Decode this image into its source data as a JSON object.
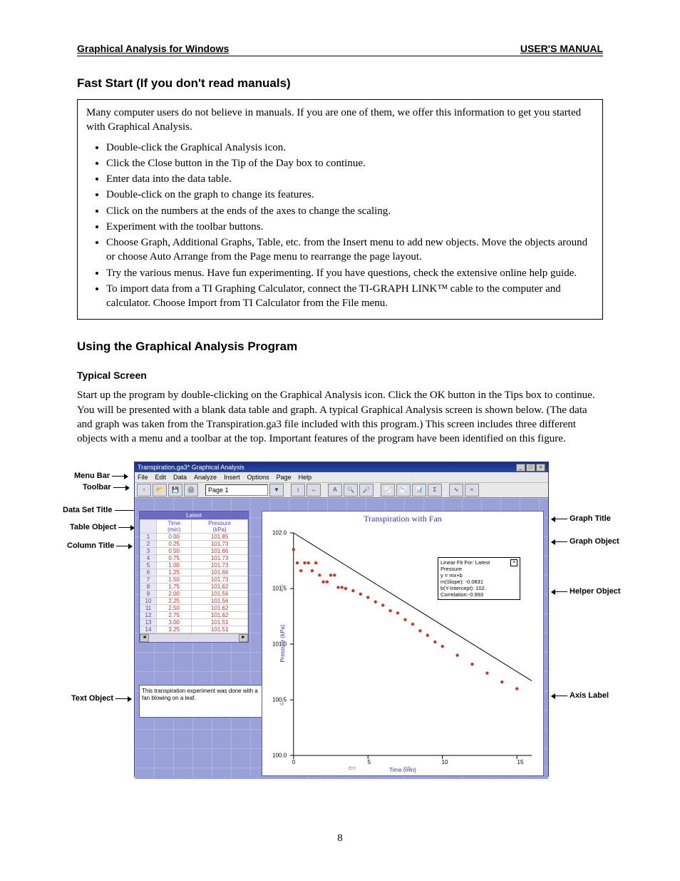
{
  "header": {
    "left": "Graphical Analysis for Windows",
    "right": "USER'S MANUAL"
  },
  "section1": {
    "title": "Fast Start (If you don't read manuals)",
    "intro": "Many computer users do not believe in manuals. If you are one of them, we offer this information to get you started with Graphical Analysis.",
    "bullets": [
      "Double-click the Graphical Analysis icon.",
      "Click the Close button in the Tip of the Day box to continue.",
      "Enter data into the data table.",
      "Double-click on the graph to change its features.",
      "Click on the numbers at the ends of the axes to change the scaling.",
      "Experiment with the toolbar buttons.",
      "Choose Graph, Additional Graphs, Table, etc. from the Insert menu to add new objects. Move the objects around or choose Auto Arrange from the Page menu to rearrange the page layout.",
      "Try the various menus. Have fun experimenting. If you have questions, check the extensive online help guide.",
      "To import data from a TI Graphing Calculator, connect the TI-GRAPH LINK™ cable to the computer and calculator. Choose Import from TI Calculator from the File menu."
    ]
  },
  "section2": {
    "title": "Using the Graphical Analysis Program",
    "sub": "Typical Screen",
    "body": "Start up the program by double-clicking on the Graphical Analysis icon. Click the OK button in the Tips box to continue. You will be presented with a blank data table and graph. A typical Graphical Analysis screen is shown below. (The data and graph was taken from the Transpiration.ga3 file included with this program.) This screen includes three different objects with a menu and a toolbar at the top. Important features of the program have been identified on this figure."
  },
  "figure": {
    "labels_left": {
      "menu_bar": "Menu Bar",
      "toolbar": "Toolbar",
      "data_set_title": "Data Set Title",
      "table_object": "Table Object",
      "column_title": "Column Title",
      "text_object": "Text Object"
    },
    "labels_right": {
      "graph_title": "Graph Title",
      "graph_object": "Graph Object",
      "helper_object": "Helper Object",
      "axis_label": "Axis Label"
    },
    "window_title": "Transpiration.ga3* Graphical Analysis",
    "menus": [
      "File",
      "Edit",
      "Data",
      "Analyze",
      "Insert",
      "Options",
      "Page",
      "Help"
    ],
    "page_selector": "Page 1",
    "dataset_title": "Latest",
    "table": {
      "col1": "Time",
      "col1_unit": "(min)",
      "col2": "Pressure",
      "col2_unit": "(kPa)",
      "rows": [
        [
          "1",
          "0.00",
          "101.85"
        ],
        [
          "2",
          "0.25",
          "101.73"
        ],
        [
          "3",
          "0.50",
          "101.66"
        ],
        [
          "4",
          "0.75",
          "101.73"
        ],
        [
          "5",
          "1.00",
          "101.73"
        ],
        [
          "6",
          "1.25",
          "101.66"
        ],
        [
          "7",
          "1.50",
          "101.73"
        ],
        [
          "8",
          "1.75",
          "101.62"
        ],
        [
          "9",
          "2.00",
          "101.56"
        ],
        [
          "10",
          "2.25",
          "101.56"
        ],
        [
          "11",
          "2.50",
          "101.62"
        ],
        [
          "12",
          "2.75",
          "101.62"
        ],
        [
          "13",
          "3.00",
          "101.51"
        ],
        [
          "14",
          "3.25",
          "101.51"
        ]
      ]
    },
    "text_object": "This transpiration experiment was done with a fan blowing on a leaf.",
    "graph": {
      "title": "Transpiration with Fan",
      "ylabel": "Pressure (kPa)",
      "xlabel": "Time (min)",
      "y_ticks": [
        "102.0",
        "101.5",
        "101.0",
        "100.5",
        "100.0"
      ],
      "x_ticks": [
        "0",
        "5",
        "10",
        "15"
      ]
    },
    "helper": {
      "line1": "Linear Fit For: Latest Pressure",
      "line2": "y = mx+b",
      "line3": "m(Slope): -0.0831",
      "line4": "b(Y-Intercept): 102.",
      "line5": "Correlation:-0.993"
    }
  },
  "chart_data": {
    "type": "scatter",
    "title": "Transpiration with Fan",
    "xlabel": "Time (min)",
    "ylabel": "Pressure (kPa)",
    "xlim": [
      0,
      16
    ],
    "ylim": [
      100.0,
      102.0
    ],
    "series": [
      {
        "name": "Latest:Pressure",
        "x": [
          0.0,
          0.25,
          0.5,
          0.75,
          1.0,
          1.25,
          1.5,
          1.75,
          2.0,
          2.25,
          2.5,
          2.75,
          3.0,
          3.25,
          3.5,
          4,
          4.5,
          5,
          5.5,
          6,
          6.5,
          7,
          7.5,
          8,
          8.5,
          9,
          9.5,
          10,
          11,
          12,
          13,
          14,
          15
        ],
        "y": [
          101.85,
          101.73,
          101.66,
          101.73,
          101.73,
          101.66,
          101.73,
          101.62,
          101.56,
          101.56,
          101.62,
          101.62,
          101.51,
          101.51,
          101.5,
          101.48,
          101.45,
          101.42,
          101.38,
          101.35,
          101.3,
          101.28,
          101.22,
          101.18,
          101.12,
          101.08,
          101.02,
          100.98,
          100.9,
          100.82,
          100.74,
          100.66,
          100.6
        ]
      }
    ],
    "fit": {
      "type": "linear",
      "equation": "y = mx + b",
      "m": -0.0831,
      "b": 102.0,
      "correlation": -0.993
    }
  },
  "page_number": "8"
}
